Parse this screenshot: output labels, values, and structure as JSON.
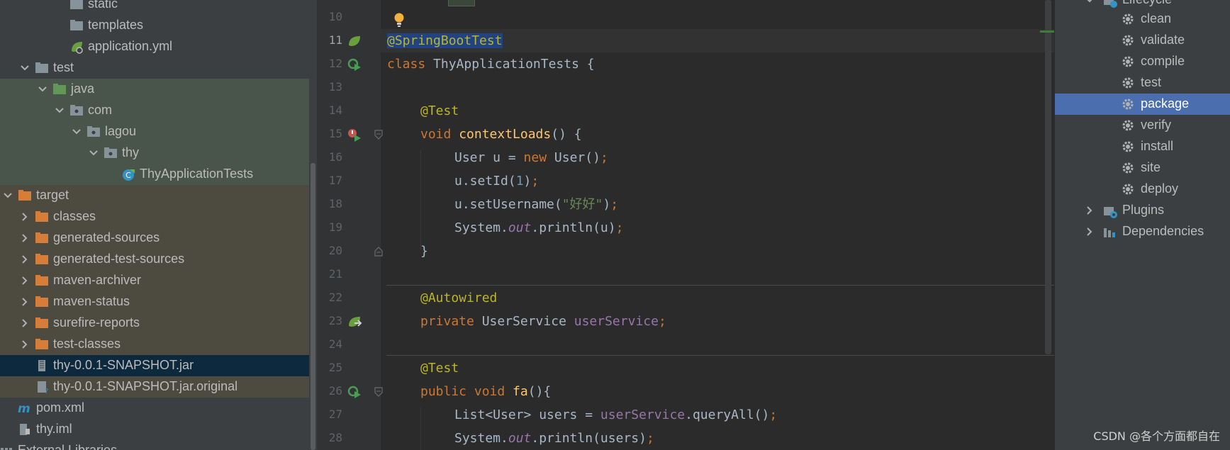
{
  "project_tree": {
    "items": [
      {
        "label": "static",
        "icon": "folder-icon"
      },
      {
        "label": "templates",
        "icon": "folder-icon"
      },
      {
        "label": "application.yml",
        "icon": "spring-yml-icon"
      },
      {
        "label": "test",
        "icon": "folder-icon"
      },
      {
        "label": "java",
        "icon": "test-source-folder-icon"
      },
      {
        "label": "com",
        "icon": "package-icon"
      },
      {
        "label": "lagou",
        "icon": "package-icon"
      },
      {
        "label": "thy",
        "icon": "package-icon"
      },
      {
        "label": "ThyApplicationTests",
        "icon": "test-class-icon"
      },
      {
        "label": "target",
        "icon": "excluded-folder-icon"
      },
      {
        "label": "classes",
        "icon": "excluded-folder-icon"
      },
      {
        "label": "generated-sources",
        "icon": "excluded-folder-icon"
      },
      {
        "label": "generated-test-sources",
        "icon": "excluded-folder-icon"
      },
      {
        "label": "maven-archiver",
        "icon": "excluded-folder-icon"
      },
      {
        "label": "maven-status",
        "icon": "excluded-folder-icon"
      },
      {
        "label": "surefire-reports",
        "icon": "excluded-folder-icon"
      },
      {
        "label": "test-classes",
        "icon": "excluded-folder-icon"
      },
      {
        "label": "thy-0.0.1-SNAPSHOT.jar",
        "icon": "jar-icon"
      },
      {
        "label": "thy-0.0.1-SNAPSHOT.jar.original",
        "icon": "unknown-file-icon"
      },
      {
        "label": "pom.xml",
        "icon": "maven-icon"
      },
      {
        "label": "thy.iml",
        "icon": "module-file-icon"
      },
      {
        "label": "External Libraries",
        "icon": "library-icon"
      }
    ]
  },
  "editor": {
    "line_numbers": [
      "10",
      "11",
      "12",
      "13",
      "14",
      "15",
      "16",
      "17",
      "18",
      "19",
      "20",
      "21",
      "22",
      "23",
      "24",
      "25",
      "26",
      "27",
      "28"
    ],
    "current_line": "11",
    "code": {
      "l11": {
        "ann": "@SpringBootTest"
      },
      "l12": {
        "kw": "class ",
        "name": "ThyApplicationTests {"
      },
      "l14": {
        "ann": "@Test"
      },
      "l15": {
        "kw": "void ",
        "fn": "contextLoads",
        "rest": "() {"
      },
      "l16": {
        "a": "User u = ",
        "kw": "new ",
        "b": "User()",
        "semi": ";"
      },
      "l17": {
        "a": "u.setId(",
        "num": "1",
        "b": ")",
        "semi": ";"
      },
      "l18": {
        "a": "u.setUsername(",
        "str": "\"好好\"",
        "b": ")",
        "semi": ";"
      },
      "l19": {
        "a": "System.",
        "ital": "out",
        "b": ".println(u)",
        "semi": ";"
      },
      "l20": {
        "a": "}"
      },
      "l22": {
        "ann": "@Autowired"
      },
      "l23": {
        "kw": "private ",
        "a": "UserService ",
        "fld": "userService",
        "semi": ";"
      },
      "l25": {
        "ann": "@Test"
      },
      "l26": {
        "kw": "public void ",
        "fn": "fa",
        "rest": "(){"
      },
      "l27": {
        "a": "List<User> users = ",
        "fld": "userService",
        "b": ".queryAll()",
        "semi": ";"
      },
      "l28": {
        "a": "System.",
        "ital": "out",
        "b": ".println(users)",
        "semi": ";"
      }
    }
  },
  "maven": {
    "lifecycle_label": "Lifecycle",
    "goals": [
      "clean",
      "validate",
      "compile",
      "test",
      "package",
      "verify",
      "install",
      "site",
      "deploy"
    ],
    "selected_goal": "package",
    "plugins_label": "Plugins",
    "dependencies_label": "Dependencies"
  },
  "watermark": "CSDN @各个方面都自在",
  "colors": {
    "selection": "#4b6eaf",
    "jar_selection": "#0d293e",
    "test_folder_bg": "#49544a",
    "excluded_folder_bg": "#4d4a3f",
    "keyword": "#cc7832",
    "annotation": "#bbb529",
    "method": "#ffc66d"
  }
}
